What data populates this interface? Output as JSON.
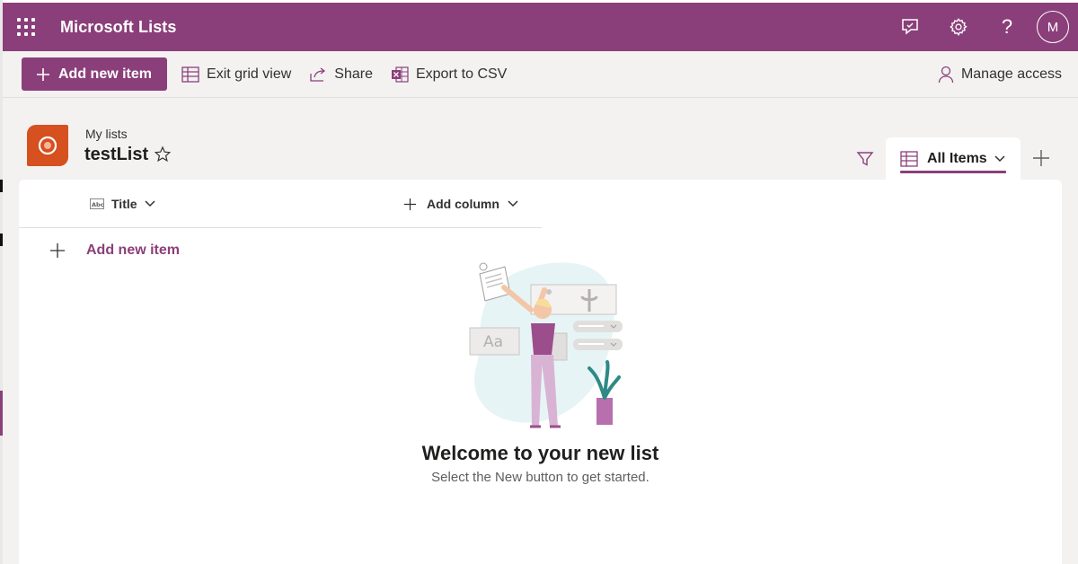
{
  "app": {
    "title": "Microsoft Lists"
  },
  "suite": {
    "feedback_icon": "feedback-icon",
    "settings_icon": "gear-icon",
    "help_label": "?",
    "avatar_initial": "M"
  },
  "commands": {
    "add_new_item": "Add new item",
    "exit_grid_view": "Exit grid view",
    "share": "Share",
    "export_csv": "Export to CSV",
    "manage_access": "Manage access"
  },
  "header": {
    "breadcrumb": "My lists",
    "list_title": "testList",
    "view_name": "All Items"
  },
  "grid": {
    "columns": [
      "Title"
    ],
    "add_column_label": "Add column",
    "add_item_label": "Add new item"
  },
  "empty_state": {
    "title": "Welcome to your new list",
    "subtitle": "Select the New button to get started.",
    "illustration_text": "Aa"
  },
  "colors": {
    "brand": "#8b3f7a",
    "list_icon": "#d65020",
    "background": "#f3f2f1"
  }
}
